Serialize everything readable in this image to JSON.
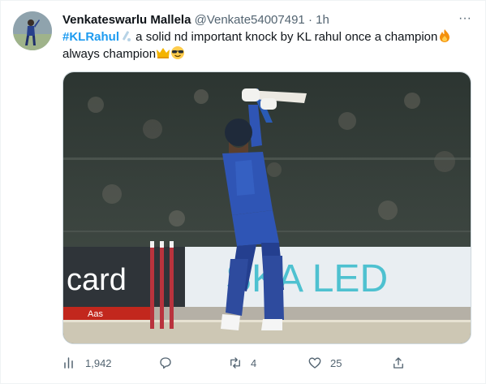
{
  "tweet": {
    "author_name": "Venkateswarlu Mallela",
    "handle": "@Venkate54007491",
    "separator": "·",
    "time": "1h",
    "more_label": "···",
    "hashtag": "#KLRahul",
    "text_part1": " a solid nd important knock by KL rahul once a champion",
    "text_part2": "always champion"
  },
  "media": {
    "banner_left": "card",
    "banner_right": "SKA LED",
    "banner_bottom_text": "Aas"
  },
  "actions": {
    "views": "1,942",
    "replies": "",
    "retweets": "4",
    "likes": "25"
  },
  "colors": {
    "accent": "#1d9bf0",
    "muted": "#536471",
    "jersey": "#2f55b5"
  }
}
